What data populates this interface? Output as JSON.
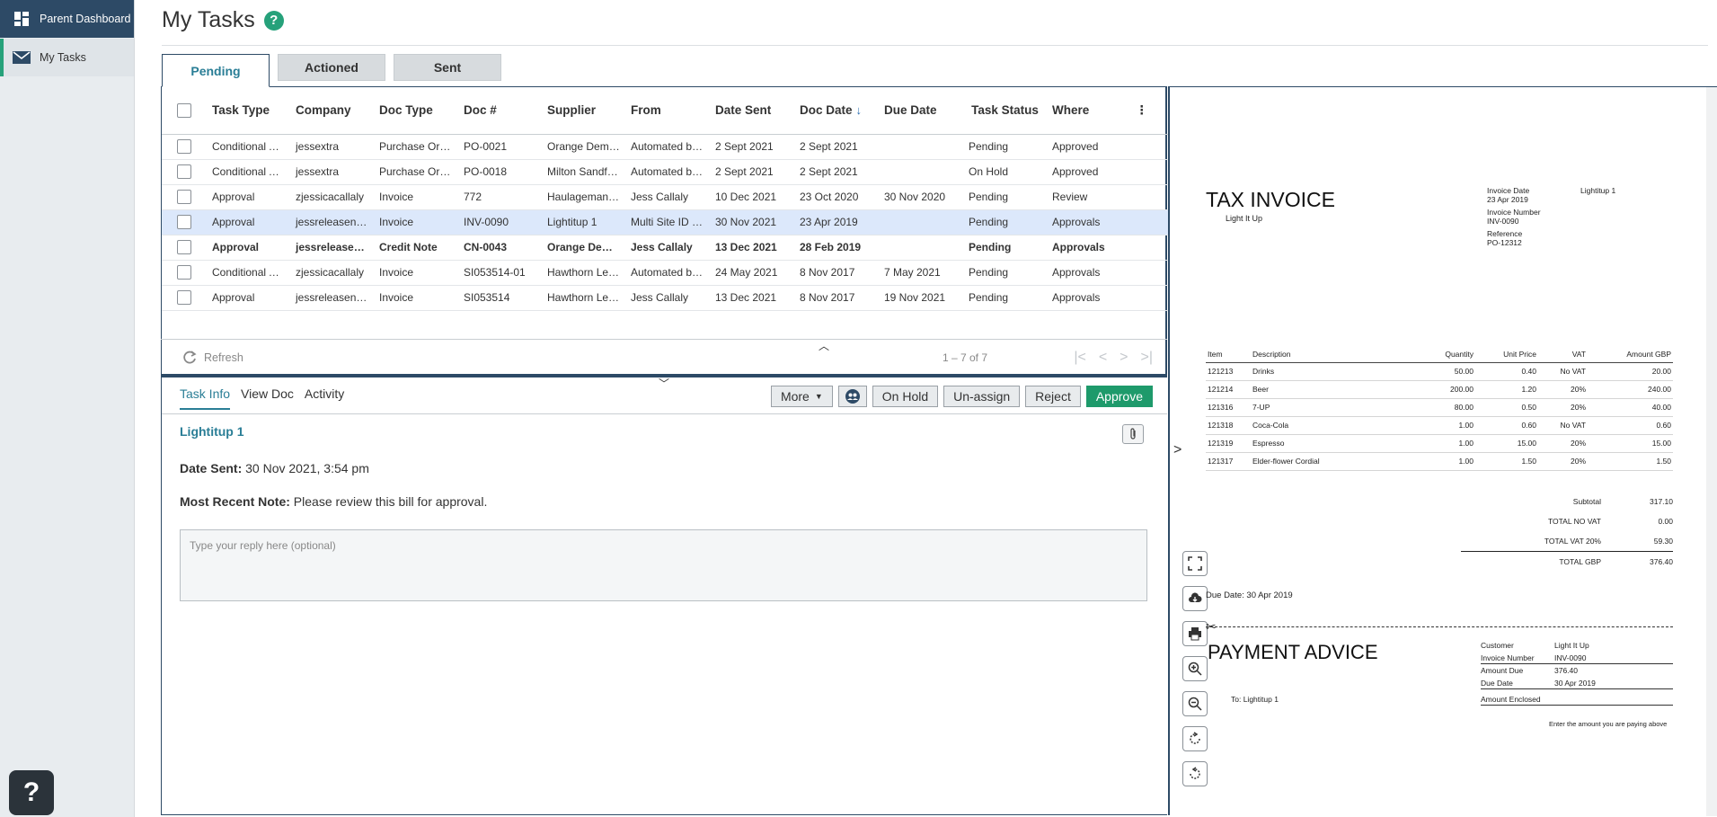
{
  "sidebar": {
    "items": [
      {
        "label": "Parent Dashboard",
        "icon": "dashboard-icon"
      },
      {
        "label": "My Tasks",
        "icon": "mail-icon"
      }
    ],
    "help_label": "?"
  },
  "header": {
    "title": "My Tasks",
    "help": "?"
  },
  "tabs": [
    {
      "label": "Pending",
      "active": true
    },
    {
      "label": "Actioned",
      "active": false
    },
    {
      "label": "Sent",
      "active": false
    }
  ],
  "grid": {
    "columns": [
      "Task Type",
      "Company",
      "Doc Type",
      "Doc #",
      "Supplier",
      "From",
      "Date Sent",
      "Doc Date",
      "Due Date",
      "Task Status",
      "Where"
    ],
    "rows": [
      {
        "task_type": "Conditional Ap...",
        "company": "jessextra",
        "doc_type": "Purchase Order",
        "doc_no": "PO-0021",
        "supplier": "Orange Demo ...",
        "from": "Automated by ...",
        "date_sent": "2 Sept 2021",
        "doc_date": "2 Sept 2021",
        "due_date": "",
        "status": "Pending",
        "where": "Approved"
      },
      {
        "task_type": "Conditional Ap...",
        "company": "jessextra",
        "doc_type": "Purchase Order",
        "doc_no": "PO-0018",
        "supplier": "Milton Sandfor...",
        "from": "Automated by ...",
        "date_sent": "2 Sept 2021",
        "doc_date": "2 Sept 2021",
        "due_date": "",
        "status": "On Hold",
        "where": "Approved"
      },
      {
        "task_type": "Approval",
        "company": "zjessicacallaly",
        "doc_type": "Invoice",
        "doc_no": "772",
        "supplier": "Haulageman Ltd",
        "from": "Jess Callaly",
        "date_sent": "10 Dec 2021",
        "doc_date": "23 Oct 2020",
        "due_date": "30 Nov 2020",
        "status": "Pending",
        "where": "Review"
      },
      {
        "task_type": "Approval",
        "company": "jessreleasenot...",
        "doc_type": "Invoice",
        "doc_no": "INV-0090",
        "supplier": "Lightitup 1",
        "from": "Multi Site ID R...",
        "date_sent": "30 Nov 2021",
        "doc_date": "23 Apr 2019",
        "due_date": "",
        "status": "Pending",
        "where": "Approvals"
      },
      {
        "task_type": "Approval",
        "company": "jessreleasenot...",
        "doc_type": "Credit Note",
        "doc_no": "CN-0043",
        "supplier": "Orange Demo ...",
        "from": "Jess Callaly",
        "date_sent": "13 Dec 2021",
        "doc_date": "28 Feb 2019",
        "due_date": "",
        "status": "Pending",
        "where": "Approvals"
      },
      {
        "task_type": "Conditional Ap...",
        "company": "zjessicacallaly",
        "doc_type": "Invoice",
        "doc_no": "SI053514-01",
        "supplier": "Hawthorn Leis...",
        "from": "Automated by ...",
        "date_sent": "24 May 2021",
        "doc_date": "8 Nov 2017",
        "due_date": "7 May 2021",
        "status": "Pending",
        "where": "Approvals"
      },
      {
        "task_type": "Approval",
        "company": "jessreleasenot...",
        "doc_type": "Invoice",
        "doc_no": "SI053514",
        "supplier": "Hawthorn Leis...",
        "from": "Jess Callaly",
        "date_sent": "13 Dec 2021",
        "doc_date": "8 Nov 2017",
        "due_date": "19 Nov 2021",
        "status": "Pending",
        "where": "Approvals"
      }
    ],
    "refresh_label": "Refresh",
    "page_info": "1 – 7 of 7"
  },
  "detail": {
    "tabs": [
      "Task Info",
      "View Doc",
      "Activity"
    ],
    "buttons": {
      "more": "More",
      "on_hold": "On Hold",
      "unassign": "Un-assign",
      "reject": "Reject",
      "approve": "Approve"
    },
    "title": "Lightitup 1",
    "date_sent_label": "Date Sent:",
    "date_sent_value": "30 Nov 2021, 3:54 pm",
    "note_label": "Most Recent Note:",
    "note_value": "Please review this bill for approval.",
    "reply_placeholder": "Type your reply here (optional)"
  },
  "document": {
    "title": "TAX INVOICE",
    "company": "Light It Up",
    "invoice_date_label": "Invoice Date",
    "invoice_date": "23 Apr 2019",
    "invoice_number_label": "Invoice Number",
    "invoice_number": "INV-0090",
    "reference_label": "Reference",
    "reference": "PO-12312",
    "supplier": "Lightitup 1",
    "columns": [
      "Item",
      "Description",
      "Quantity",
      "Unit Price",
      "VAT",
      "Amount GBP"
    ],
    "lines": [
      [
        "121213",
        "Drinks",
        "50.00",
        "0.40",
        "No VAT",
        "20.00"
      ],
      [
        "121214",
        "Beer",
        "200.00",
        "1.20",
        "20%",
        "240.00"
      ],
      [
        "121316",
        "7-UP",
        "80.00",
        "0.50",
        "20%",
        "40.00"
      ],
      [
        "121318",
        "Coca-Cola",
        "1.00",
        "0.60",
        "No VAT",
        "0.60"
      ],
      [
        "121319",
        "Espresso",
        "1.00",
        "15.00",
        "20%",
        "15.00"
      ],
      [
        "121317",
        "Elder-flower Cordial",
        "1.00",
        "1.50",
        "20%",
        "1.50"
      ]
    ],
    "totals": [
      {
        "label": "Subtotal",
        "value": "317.10"
      },
      {
        "label": "TOTAL  NO VAT",
        "value": "0.00"
      },
      {
        "label": "TOTAL  VAT  20%",
        "value": "59.30"
      },
      {
        "label": "TOTAL GBP",
        "value": "376.40"
      }
    ],
    "due_date": "Due Date: 30 Apr 2019",
    "payment_title": "PAYMENT ADVICE",
    "pay_to": "To: Lightitup 1",
    "pay_meta": [
      {
        "label": "Customer",
        "value": "Light It Up"
      },
      {
        "label": "Invoice Number",
        "value": "INV-0090"
      },
      {
        "label": "Amount Due",
        "value": "376.40"
      },
      {
        "label": "Due Date",
        "value": "30 Apr 2019"
      },
      {
        "label": "Amount Enclosed",
        "value": ""
      }
    ],
    "enclose_note": "Enter the amount you are paying above"
  }
}
